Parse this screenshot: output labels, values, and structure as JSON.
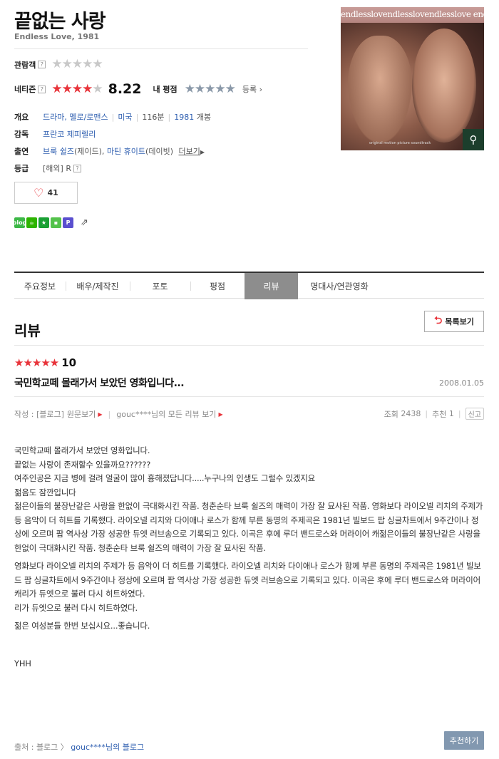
{
  "movie": {
    "title": "끝없는 사랑",
    "subtitle": "Endless Love, 1981"
  },
  "ratings": {
    "audience_label": "관람객",
    "netizen_label": "네티즌",
    "netizen_score": "8.22",
    "netizen_stars": 4,
    "my_rating_label": "내 평점",
    "register_label": "등록 ›",
    "help": "?"
  },
  "info": {
    "overview_label": "개요",
    "genre": "드라마, 멜로/로맨스",
    "country": "미국",
    "runtime": "116분",
    "year": "1981",
    "release": "개봉",
    "director_label": "감독",
    "director": "프란코 제피렐리",
    "cast_label": "출연",
    "cast1": "브룩 쉴즈",
    "cast1_role": "(제이드),",
    "cast2": "마틴 휴이트",
    "cast2_role": "(데이빗)",
    "more_label": "더보기",
    "grade_label": "등급",
    "grade": "[해외] R"
  },
  "likes": {
    "count": "41"
  },
  "poster": {
    "band_text": "endlesslovendlesslovendlesslove endlessloveendlesslove",
    "caption": "original motion picture soundtrack"
  },
  "tabs": [
    {
      "label": "주요정보"
    },
    {
      "label": "배우/제작진"
    },
    {
      "label": "포토"
    },
    {
      "label": "평점"
    },
    {
      "label": "리뷰"
    },
    {
      "label": "명대사/연관영화"
    }
  ],
  "review_section": {
    "title": "리뷰",
    "list_button": "목록보기"
  },
  "review": {
    "stars": 5,
    "score": "10",
    "title": "국민학교떼 몰래가서 보았던 영화입니다...",
    "date": "2008.01.05",
    "author_prefix": "작성 : [블로그]",
    "original_link": "원문보기",
    "all_reviews": "gouc****님의 모든 리뷰 보기",
    "views_label": "조회",
    "views": "2438",
    "recommend_label": "추천",
    "recommend": "1",
    "report": "신고",
    "paragraphs": [
      "국민학교떼 몰래가서 보았던 영화입니다.",
      "끝없는 사랑이 존재할수 있을까요??????",
      "여주인공은 지금 병에 걸려 얼굴이 많이 흉해졌답니다.....누구나의 인생도 그럴수 있겠지요",
      "젊음도 잠깐입니다",
      "젊은이들의 불장난같은 사랑을 한없이 극대화시킨 작품. 청춘순타 브룩 쉴즈의 매력이 가장 잘 묘사된 작품. 영화보다 라이오넬 리치의 주제가 등 음악이 더 히트를 기록했다. 라이오넬 리치와 다이애나 로스가 함께 부른 동명의 주제곡은 1981년 빌보드 팝 싱글차트에서 9주간이나 정상에 오르며 팝 역사상 가장 성공한 듀엣 러브송으로 기록되고 있다. 이곡은 후에 루더 밴드로스와 머라이어 캐젊은이들의 불장난같은 사랑을 한없이 극대화시킨 작품. 청춘순타 브룩 쉴즈의 매력이 가장 잘 묘사된 작품.",
      "영화보다 라이오넬 리치의 주제가 등 음악이 더 히트를 기록했다. 라이오넬 리치와 다이애나 로스가 함께 부른 동명의 주제곡은 1981년 빌보드 팝 싱글차트에서 9주간이나 정상에 오르며 팝 역사상 가장 성공한 듀엣 러브송으로 기록되고 있다. 이곡은 후에 루더 밴드로스와 머라이어 캐리가 듀엣으로 불러 다시 히트하였다.",
      "리가 듀엣으로 불러 다시 히트하였다.",
      "젊은 여성분들 한번 보십시요...좋습니다.",
      "YHH"
    ],
    "source_label": "출처 : 블로그 〉",
    "source_link": "gouc****님의 블로그",
    "recommend_button": "추천하기"
  },
  "colors": {
    "accent_red": "#e8333a",
    "link_blue": "#2f5fb0",
    "active_tab": "#8d8d8d"
  }
}
